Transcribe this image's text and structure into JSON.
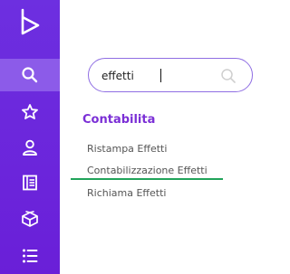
{
  "sidebar": {
    "logo_icon": "play-logo-icon",
    "items": [
      {
        "icon": "search-icon",
        "active": true
      },
      {
        "icon": "star-icon",
        "active": false
      },
      {
        "icon": "user-icon",
        "active": false
      },
      {
        "icon": "ledger-icon",
        "active": false
      },
      {
        "icon": "gift-box-icon",
        "active": false
      },
      {
        "icon": "list-icon",
        "active": false
      }
    ]
  },
  "search": {
    "value": "effetti",
    "icon": "search-icon"
  },
  "results": {
    "section_title": "Contabilita",
    "items": [
      {
        "label": "Ristampa Effetti"
      },
      {
        "label": "Contabilizzazione Effetti"
      },
      {
        "label": "Richiama Effetti"
      }
    ]
  },
  "colors": {
    "sidebar": "#6d2fe0",
    "sidebar_active": "#8c5be9",
    "accent": "#7b2fd6",
    "search_border": "#8f6ee3",
    "highlight": "#21a35a"
  }
}
